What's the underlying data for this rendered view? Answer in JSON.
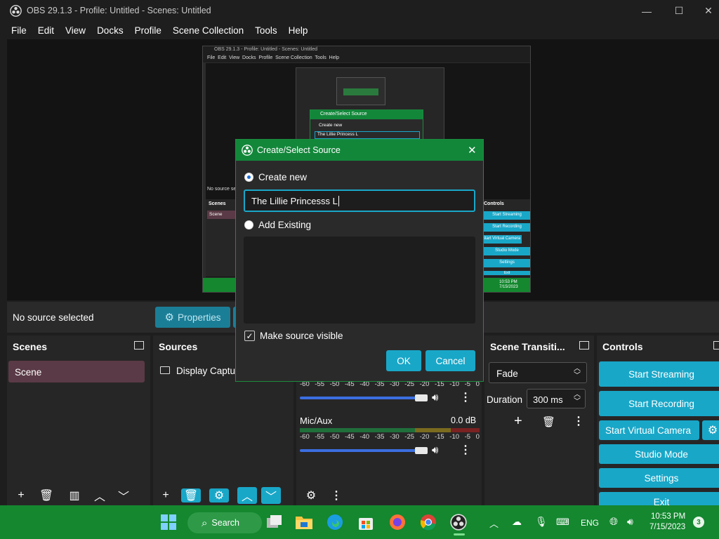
{
  "window": {
    "title": "OBS 29.1.3 - Profile: Untitled - Scenes: Untitled",
    "minimize": "—",
    "maximize": "☐",
    "close": "✕"
  },
  "menu": [
    "File",
    "Edit",
    "View",
    "Docks",
    "Profile",
    "Scene Collection",
    "Tools",
    "Help"
  ],
  "preview": {
    "mini_title": "OBS 29.1.3 - Profile: Untitled - Scenes: Untitled",
    "mini_menu": "File  Edit  View  Docks  Profile  Scene Collection  Tools  Help",
    "mini_dialog_title": "Create/Select Source",
    "mini_create_new": "Create new",
    "mini_input": "The Lillie Princess L",
    "mini_no_source": "No source sele",
    "mini_scenes": "Scenes",
    "mini_scene": "Scene",
    "mini_controls": "Controls",
    "mini_buttons": [
      "Start Streaming",
      "Start Recording",
      "Start Virtual Camera",
      "Studio Mode",
      "Settings",
      "Exit"
    ],
    "mini_time": "10:53 PM",
    "mini_date": "7/15/2023"
  },
  "source_toolbar": {
    "status": "No source selected",
    "properties": "Properties"
  },
  "scenes": {
    "title": "Scenes",
    "items": [
      "Scene"
    ]
  },
  "sources": {
    "title": "Sources",
    "items": [
      "Display Captur"
    ]
  },
  "mixer": {
    "ticks": [
      "-60",
      "-55",
      "-50",
      "-45",
      "-40",
      "-35",
      "-30",
      "-25",
      "-20",
      "-15",
      "-10",
      "-5",
      "0"
    ],
    "track2_name": "Mic/Aux",
    "track2_db": "0.0 dB"
  },
  "transitions": {
    "title": "Scene Transiti...",
    "selected": "Fade",
    "duration_label": "Duration",
    "duration_value": "300 ms"
  },
  "controls": {
    "title": "Controls",
    "start_streaming": "Start Streaming",
    "start_recording": "Start Recording",
    "start_virtual_camera": "Start Virtual Camera",
    "studio_mode": "Studio Mode",
    "settings": "Settings",
    "exit": "Exit"
  },
  "dialog": {
    "title": "Create/Select Source",
    "create_new": "Create new",
    "name_value": "The Lillie Princesss L",
    "add_existing": "Add Existing",
    "make_visible": "Make source visible",
    "ok": "OK",
    "cancel": "Cancel"
  },
  "taskbar": {
    "search": "Search",
    "lang": "ENG",
    "time": "10:53 PM",
    "date": "7/15/2023",
    "badge": "3"
  }
}
